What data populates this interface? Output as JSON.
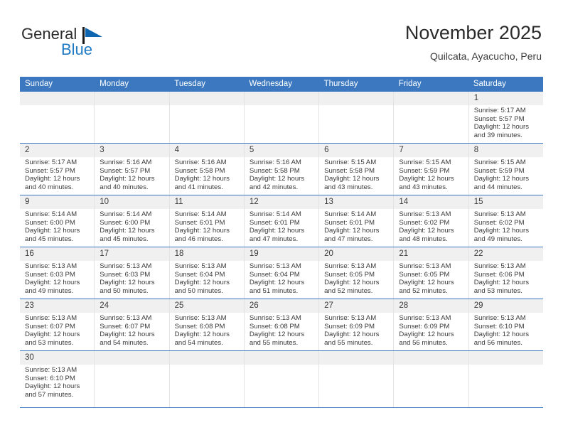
{
  "brand": {
    "name_top": "General",
    "name_bottom": "Blue",
    "flag_icon": "triangle-flag-icon",
    "color_primary": "#1f7ac4",
    "color_text": "#2b2b2b"
  },
  "header": {
    "title": "November 2025",
    "subtitle": "Quilcata, Ayacucho, Peru"
  },
  "theme": {
    "header_row_bg": "#3b78bf",
    "header_row_text": "#ffffff",
    "row_divider": "#3b78bf",
    "daynum_bar_bg": "#f0f0f0",
    "cell_divider": "#e3e3e3"
  },
  "calendar": {
    "weekday_headers": [
      "Sunday",
      "Monday",
      "Tuesday",
      "Wednesday",
      "Thursday",
      "Friday",
      "Saturday"
    ],
    "weeks": [
      [
        {
          "day": "",
          "lines": []
        },
        {
          "day": "",
          "lines": []
        },
        {
          "day": "",
          "lines": []
        },
        {
          "day": "",
          "lines": []
        },
        {
          "day": "",
          "lines": []
        },
        {
          "day": "",
          "lines": []
        },
        {
          "day": "1",
          "lines": [
            "Sunrise: 5:17 AM",
            "Sunset: 5:57 PM",
            "Daylight: 12 hours",
            "and 39 minutes."
          ]
        }
      ],
      [
        {
          "day": "2",
          "lines": [
            "Sunrise: 5:17 AM",
            "Sunset: 5:57 PM",
            "Daylight: 12 hours",
            "and 40 minutes."
          ]
        },
        {
          "day": "3",
          "lines": [
            "Sunrise: 5:16 AM",
            "Sunset: 5:57 PM",
            "Daylight: 12 hours",
            "and 40 minutes."
          ]
        },
        {
          "day": "4",
          "lines": [
            "Sunrise: 5:16 AM",
            "Sunset: 5:58 PM",
            "Daylight: 12 hours",
            "and 41 minutes."
          ]
        },
        {
          "day": "5",
          "lines": [
            "Sunrise: 5:16 AM",
            "Sunset: 5:58 PM",
            "Daylight: 12 hours",
            "and 42 minutes."
          ]
        },
        {
          "day": "6",
          "lines": [
            "Sunrise: 5:15 AM",
            "Sunset: 5:58 PM",
            "Daylight: 12 hours",
            "and 43 minutes."
          ]
        },
        {
          "day": "7",
          "lines": [
            "Sunrise: 5:15 AM",
            "Sunset: 5:59 PM",
            "Daylight: 12 hours",
            "and 43 minutes."
          ]
        },
        {
          "day": "8",
          "lines": [
            "Sunrise: 5:15 AM",
            "Sunset: 5:59 PM",
            "Daylight: 12 hours",
            "and 44 minutes."
          ]
        }
      ],
      [
        {
          "day": "9",
          "lines": [
            "Sunrise: 5:14 AM",
            "Sunset: 6:00 PM",
            "Daylight: 12 hours",
            "and 45 minutes."
          ]
        },
        {
          "day": "10",
          "lines": [
            "Sunrise: 5:14 AM",
            "Sunset: 6:00 PM",
            "Daylight: 12 hours",
            "and 45 minutes."
          ]
        },
        {
          "day": "11",
          "lines": [
            "Sunrise: 5:14 AM",
            "Sunset: 6:01 PM",
            "Daylight: 12 hours",
            "and 46 minutes."
          ]
        },
        {
          "day": "12",
          "lines": [
            "Sunrise: 5:14 AM",
            "Sunset: 6:01 PM",
            "Daylight: 12 hours",
            "and 47 minutes."
          ]
        },
        {
          "day": "13",
          "lines": [
            "Sunrise: 5:14 AM",
            "Sunset: 6:01 PM",
            "Daylight: 12 hours",
            "and 47 minutes."
          ]
        },
        {
          "day": "14",
          "lines": [
            "Sunrise: 5:13 AM",
            "Sunset: 6:02 PM",
            "Daylight: 12 hours",
            "and 48 minutes."
          ]
        },
        {
          "day": "15",
          "lines": [
            "Sunrise: 5:13 AM",
            "Sunset: 6:02 PM",
            "Daylight: 12 hours",
            "and 49 minutes."
          ]
        }
      ],
      [
        {
          "day": "16",
          "lines": [
            "Sunrise: 5:13 AM",
            "Sunset: 6:03 PM",
            "Daylight: 12 hours",
            "and 49 minutes."
          ]
        },
        {
          "day": "17",
          "lines": [
            "Sunrise: 5:13 AM",
            "Sunset: 6:03 PM",
            "Daylight: 12 hours",
            "and 50 minutes."
          ]
        },
        {
          "day": "18",
          "lines": [
            "Sunrise: 5:13 AM",
            "Sunset: 6:04 PM",
            "Daylight: 12 hours",
            "and 50 minutes."
          ]
        },
        {
          "day": "19",
          "lines": [
            "Sunrise: 5:13 AM",
            "Sunset: 6:04 PM",
            "Daylight: 12 hours",
            "and 51 minutes."
          ]
        },
        {
          "day": "20",
          "lines": [
            "Sunrise: 5:13 AM",
            "Sunset: 6:05 PM",
            "Daylight: 12 hours",
            "and 52 minutes."
          ]
        },
        {
          "day": "21",
          "lines": [
            "Sunrise: 5:13 AM",
            "Sunset: 6:05 PM",
            "Daylight: 12 hours",
            "and 52 minutes."
          ]
        },
        {
          "day": "22",
          "lines": [
            "Sunrise: 5:13 AM",
            "Sunset: 6:06 PM",
            "Daylight: 12 hours",
            "and 53 minutes."
          ]
        }
      ],
      [
        {
          "day": "23",
          "lines": [
            "Sunrise: 5:13 AM",
            "Sunset: 6:07 PM",
            "Daylight: 12 hours",
            "and 53 minutes."
          ]
        },
        {
          "day": "24",
          "lines": [
            "Sunrise: 5:13 AM",
            "Sunset: 6:07 PM",
            "Daylight: 12 hours",
            "and 54 minutes."
          ]
        },
        {
          "day": "25",
          "lines": [
            "Sunrise: 5:13 AM",
            "Sunset: 6:08 PM",
            "Daylight: 12 hours",
            "and 54 minutes."
          ]
        },
        {
          "day": "26",
          "lines": [
            "Sunrise: 5:13 AM",
            "Sunset: 6:08 PM",
            "Daylight: 12 hours",
            "and 55 minutes."
          ]
        },
        {
          "day": "27",
          "lines": [
            "Sunrise: 5:13 AM",
            "Sunset: 6:09 PM",
            "Daylight: 12 hours",
            "and 55 minutes."
          ]
        },
        {
          "day": "28",
          "lines": [
            "Sunrise: 5:13 AM",
            "Sunset: 6:09 PM",
            "Daylight: 12 hours",
            "and 56 minutes."
          ]
        },
        {
          "day": "29",
          "lines": [
            "Sunrise: 5:13 AM",
            "Sunset: 6:10 PM",
            "Daylight: 12 hours",
            "and 56 minutes."
          ]
        }
      ],
      [
        {
          "day": "30",
          "lines": [
            "Sunrise: 5:13 AM",
            "Sunset: 6:10 PM",
            "Daylight: 12 hours",
            "and 57 minutes."
          ]
        },
        {
          "day": "",
          "lines": []
        },
        {
          "day": "",
          "lines": []
        },
        {
          "day": "",
          "lines": []
        },
        {
          "day": "",
          "lines": []
        },
        {
          "day": "",
          "lines": []
        },
        {
          "day": "",
          "lines": []
        }
      ]
    ]
  }
}
